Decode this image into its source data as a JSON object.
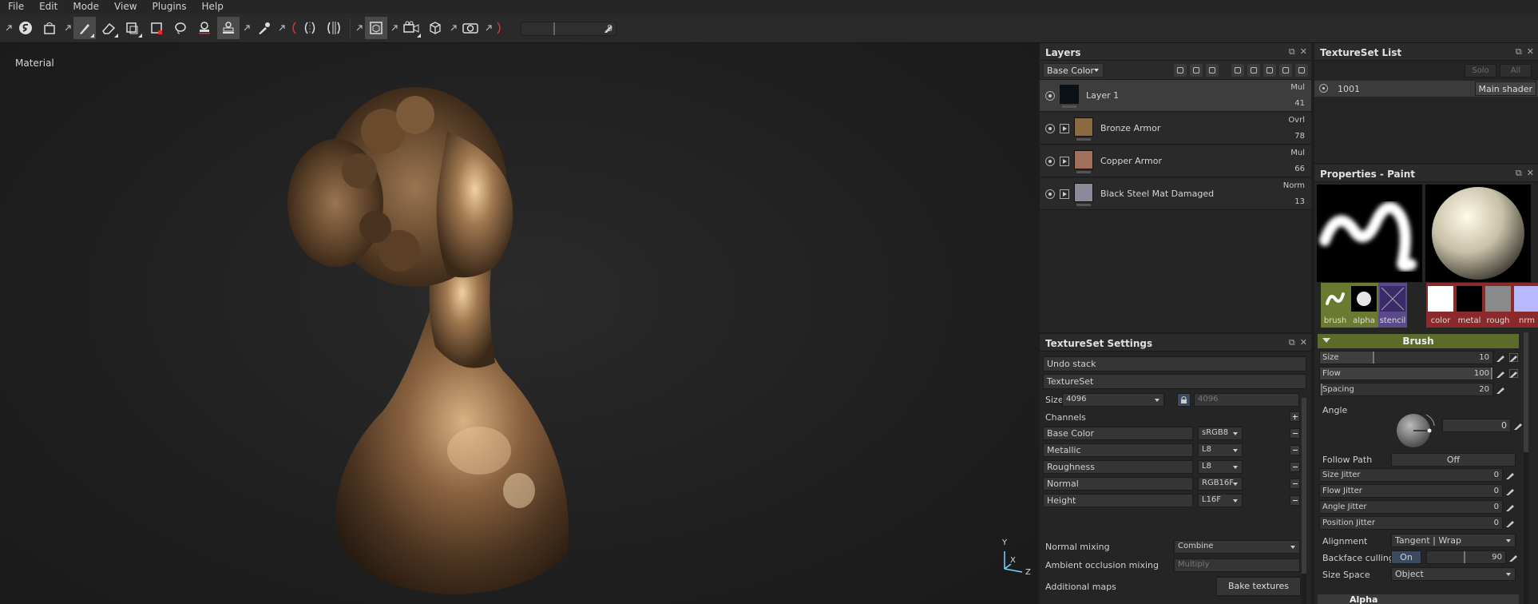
{
  "menu": [
    "File",
    "Edit",
    "Mode",
    "View",
    "Plugins",
    "Help"
  ],
  "toolbar": {
    "tools": [
      "logo-s-icon",
      "bag-icon",
      "paint-brush-icon",
      "eraser-icon",
      "projection-icon",
      "polygon-fill-icon",
      "lasso-icon",
      "smudge-icon",
      "clone-icon",
      "picker-icon",
      "symmetry-icon",
      "mirror-icon",
      "camera-icon",
      "cube-icon",
      "screenshot-icon"
    ],
    "slider_value": "8"
  },
  "viewport": {
    "label": "Material",
    "axis": {
      "y": "Y",
      "x": "X",
      "z": "Z"
    }
  },
  "layers": {
    "title": "Layers",
    "channel": "Base Color",
    "items": [
      {
        "name": "Layer 1",
        "blend": "Mul",
        "opacity": "41",
        "selected": true,
        "group": false,
        "thumb": "#0a1218"
      },
      {
        "name": "Bronze Armor",
        "blend": "Ovrl",
        "opacity": "78",
        "selected": false,
        "group": true,
        "thumb": "#8a6a40"
      },
      {
        "name": "Copper Armor",
        "blend": "Mul",
        "opacity": "66",
        "selected": false,
        "group": true,
        "thumb": "#a0705a"
      },
      {
        "name": "Black Steel Mat Damaged",
        "blend": "Norm",
        "opacity": "13",
        "selected": false,
        "group": true,
        "thumb": "#8a8a9a"
      }
    ]
  },
  "textureset_settings": {
    "title": "TextureSet Settings",
    "undo_stack": "Undo stack",
    "textureset": "TextureSet",
    "size_label": "Size",
    "size_value": "4096",
    "size_value2": "4096",
    "channels_label": "Channels",
    "channels": [
      {
        "name": "Base Color",
        "format": "sRGB8"
      },
      {
        "name": "Metallic",
        "format": "L8"
      },
      {
        "name": "Roughness",
        "format": "L8"
      },
      {
        "name": "Normal",
        "format": "RGB16F"
      },
      {
        "name": "Height",
        "format": "L16F"
      }
    ],
    "normal_mixing_label": "Normal mixing",
    "normal_mixing_value": "Combine",
    "ao_mixing_label": "Ambient occlusion mixing",
    "ao_mixing_value": "Multiply",
    "additional_maps_label": "Additional maps",
    "bake_button": "Bake textures"
  },
  "textureset_list": {
    "title": "TextureSet List",
    "solo": "Solo",
    "all": "All",
    "item_id": "1001",
    "shader": "Main shader"
  },
  "properties": {
    "title": "Properties - Paint",
    "slots": [
      {
        "label": "brush",
        "color": "#6a7a30"
      },
      {
        "label": "alpha",
        "color": "#6a7a30"
      },
      {
        "label": "stencil",
        "color": "#5a4a8a"
      }
    ],
    "material_slots": [
      {
        "label": "color",
        "color": "#ffffff"
      },
      {
        "label": "metal",
        "color": "#000000"
      },
      {
        "label": "rough",
        "color": "#8a8a8a"
      },
      {
        "label": "nrm",
        "color": "#b8b8ff"
      }
    ],
    "brush_header": "Brush",
    "size_label": "Size",
    "size_value": "10",
    "flow_label": "Flow",
    "flow_value": "100",
    "spacing_label": "Spacing",
    "spacing_value": "20",
    "angle_label": "Angle",
    "angle_value": "0",
    "follow_path_label": "Follow Path",
    "follow_path_value": "Off",
    "size_jitter_label": "Size Jitter",
    "size_jitter_value": "0",
    "flow_jitter_label": "Flow Jitter",
    "flow_jitter_value": "0",
    "angle_jitter_label": "Angle Jitter",
    "angle_jitter_value": "0",
    "position_jitter_label": "Position Jitter",
    "position_jitter_value": "0",
    "alignment_label": "Alignment",
    "alignment_value": "Tangent | Wrap",
    "backface_label": "Backface culling",
    "backface_toggle": "On",
    "backface_value": "90",
    "size_space_label": "Size Space",
    "size_space_value": "Object",
    "alpha_header": "Alpha"
  }
}
